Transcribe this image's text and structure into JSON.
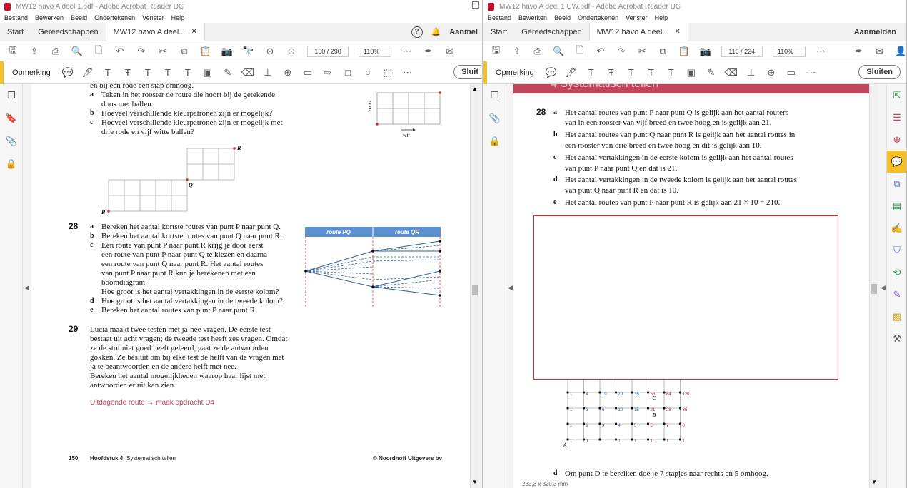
{
  "left": {
    "title": "MW12 havo A deel 1.pdf - Adobe Acrobat Reader DC",
    "menu": [
      "Bestand",
      "Bewerken",
      "Beeld",
      "Ondertekenen",
      "Venster",
      "Help"
    ],
    "tabs": {
      "start": "Start",
      "tools": "Gereedschappen",
      "doc": "MW12 havo A deel...",
      "sign_in": "Aanmel"
    },
    "toolbar": {
      "page": "150 / 290",
      "zoom": "110%"
    },
    "comment": {
      "label": "Opmerking",
      "close": "Sluit"
    },
    "content": {
      "top_line": "en bij een rode een stap omhoog.",
      "q27a_lbl": "a",
      "q27a": "Teken in het rooster de route die hoort bij de getekende",
      "q27a2": "doos met ballen.",
      "q27b_lbl": "b",
      "q27b": "Hoeveel verschillende kleurpatronen zijn er mogelijk?",
      "q27c_lbl": "c",
      "q27c": "Hoeveel verschillende kleurpatronen zijn er mogelijk met",
      "q27c2": "drie rode en vijf witte ballen?",
      "axis_rood": "rood",
      "axis_wit": "wit",
      "pt_R": "R",
      "pt_Q": "Q",
      "pt_P": "P",
      "q28_num": "28",
      "q28a_lbl": "a",
      "q28a": "Bereken het aantal kortste routes van punt P naar punt Q.",
      "q28b_lbl": "b",
      "q28b": "Bereken het aantal kortste routes van punt Q naar punt R.",
      "q28c_lbl": "c",
      "q28c_lines": [
        "Een route van punt P naar punt R krijg je door eerst",
        "een route van punt P naar punt Q te kiezen en daarna",
        "een route van punt Q naar punt R. Het aantal routes",
        "van punt P naar punt R kun je berekenen met een",
        "boomdiagram.",
        "Hoe groot is het aantal vertakkingen in de eerste kolom?"
      ],
      "q28d_lbl": "d",
      "q28d": "Hoe groot is het aantal vertakkingen in de tweede kolom?",
      "q28e_lbl": "e",
      "q28e": "Bereken het aantal routes van punt P naar punt R.",
      "tree_h1": "route PQ",
      "tree_h2": "route QR",
      "q29_num": "29",
      "q29_lines": [
        "Lucia maakt twee testen met ja-nee vragen. De eerste test",
        "bestaat uit acht vragen; de tweede test heeft zes vragen. Omdat",
        "ze de stof niet goed heeft geleerd, gaat ze de antwoorden",
        "gokken. Ze besluit om bij elke test de helft van de vragen met",
        "ja te beantwoorden en de andere helft met nee.",
        "Bereken het aantal mogelijkheden waarop haar lijst met",
        "antwoorden er uit kan zien."
      ],
      "uitdagend": "Uitdagende route → maak opdracht U4",
      "footer_page": "150",
      "footer_chapter": "Hoofdstuk 4",
      "footer_chapter_title": "Systematisch tellen",
      "footer_pub": "© Noordhoff Uitgevers bv"
    }
  },
  "right": {
    "title": "MW12 havo A deel 1 UW.pdf - Adobe Acrobat Reader DC",
    "menu": [
      "Bestand",
      "Bewerken",
      "Beeld",
      "Ondertekenen",
      "Venster",
      "Help"
    ],
    "tabs": {
      "start": "Start",
      "tools": "Gereedschappen",
      "doc": "MW12 havo A deel...",
      "sign_in": "Aanmelden"
    },
    "toolbar": {
      "page": "116 / 224",
      "zoom": "110%"
    },
    "comment": {
      "label": "Opmerking",
      "close": "Sluiten"
    },
    "content": {
      "banner": "4  Systematisch tellen",
      "q28_num": "28",
      "a_lbl": "a",
      "a1": "Het aantal routes van punt P naar punt Q is gelijk aan het aantal routers",
      "a2": "van in een rooster van vijf breed en twee hoog en is gelijk aan 21.",
      "b_lbl": "b",
      "b1": "Het aantal routes van punt Q naar punt R is gelijk aan het aantal routes in",
      "b2": "een rooster van drie breed en twee hoog en dit is gelijk aan 10.",
      "c_lbl": "c",
      "c1": "Het aantal vertakkingen in de eerste kolom is gelijk aan het aantal routes",
      "c2": "van punt P naar punt Q en dat is 21.",
      "d_lbl": "d",
      "d1": "Het aantal vertakkingen in de tweede kolom is gelijk aan het aantal routes",
      "d2": "van punt Q naar punt R en dat is 10.",
      "e_lbl": "e",
      "e1": "Het aantal routes van punt P naar punt R is gelijk aan 21 × 10 = 210.",
      "grid_rows": [
        [
          "1",
          "5",
          "15",
          "35",
          "70",
          "126",
          "210",
          "330"
        ],
        [
          "1",
          "4",
          "10",
          "20",
          "35",
          "56",
          "84",
          "120"
        ],
        [
          "1",
          "3",
          "6",
          "10",
          "15",
          "21",
          "28",
          "36"
        ],
        [
          "1",
          "2",
          "3",
          "4",
          "5",
          "6",
          "7",
          "8"
        ],
        [
          "1",
          "1",
          "1",
          "1",
          "1",
          "1",
          "1",
          "1"
        ]
      ],
      "grid_C": "C",
      "grid_B": "B",
      "grid_A": "A",
      "bottom_lbl": "d",
      "bottom": "Om punt D te bereiken doe je 7 stapjes naar rechts en 5 omhoog.",
      "status": "233,3 x 320,3 mm"
    }
  },
  "colors": {
    "accent": "#f4c025",
    "redbox": "#d32f2f",
    "banner": "#c2455a",
    "tree": "#2c5d9a",
    "tree_header": "#5b8fd0"
  }
}
